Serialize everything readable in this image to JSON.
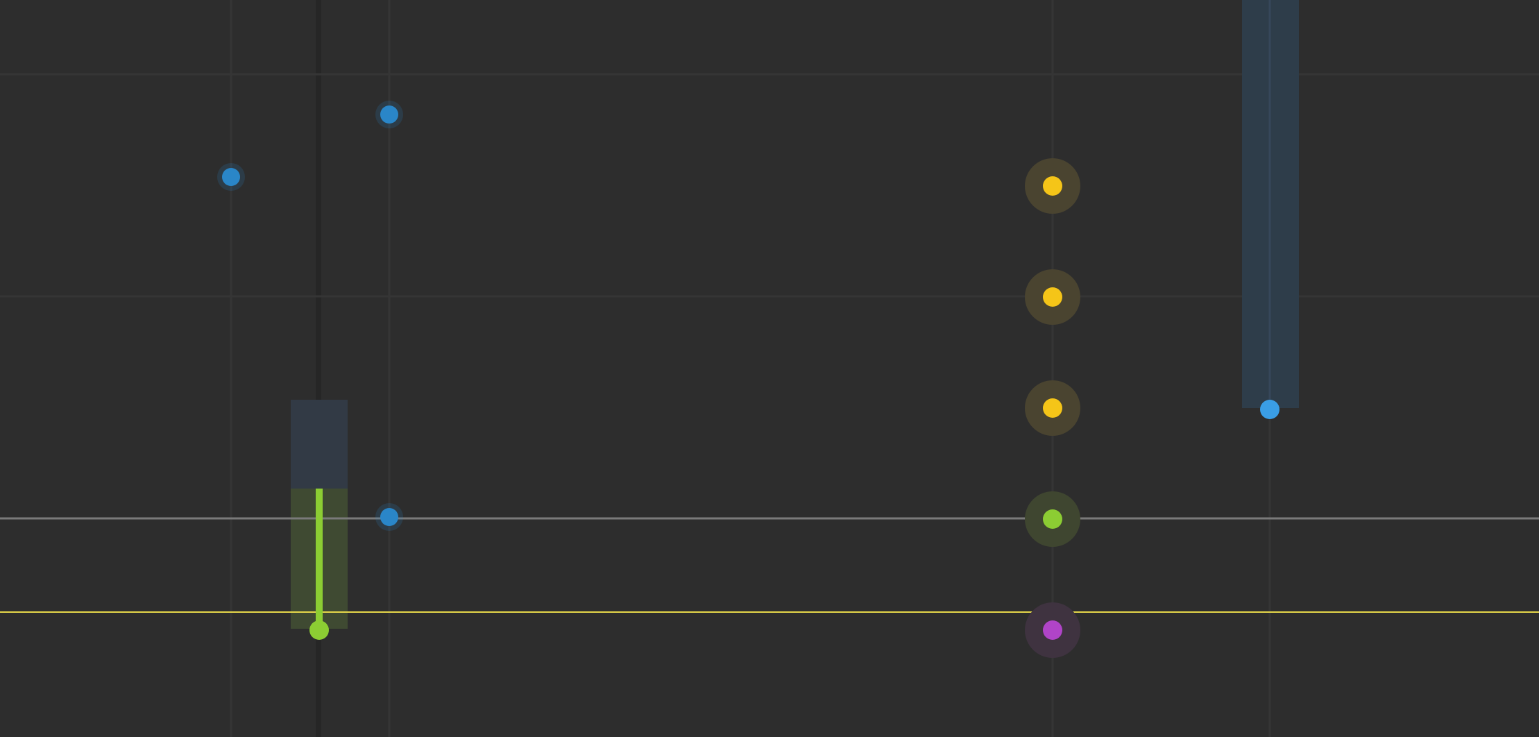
{
  "colors": {
    "background": "#2d2d2d",
    "grid_line": "#353535",
    "dark_track": "#262626",
    "playhead": "#7a7a7a",
    "threshold": "#e6d84a",
    "blue_dot": "#2a86c8",
    "blue_dot_bright": "#3a9ee6",
    "blue_region": "#2e3d4a",
    "slate_region": "#323a45",
    "green_region": "#3f4a32",
    "green": "#8ccd33",
    "yellow": "#f5c518",
    "yellow_halo": "#4a4430",
    "green_halo": "#3f4630",
    "purple": "#b044c8",
    "purple_halo": "#3f3340"
  },
  "icons": {
    "keyframe": "circle-dot-icon",
    "selected_keyframe": "halo-circle-icon"
  },
  "marker_column": {
    "markers": [
      {
        "name": "yellow-keyframe-1",
        "color_key": "yellow",
        "halo_key": "yellow_halo"
      },
      {
        "name": "yellow-keyframe-2",
        "color_key": "yellow",
        "halo_key": "yellow_halo"
      },
      {
        "name": "yellow-keyframe-3",
        "color_key": "yellow",
        "halo_key": "yellow_halo"
      },
      {
        "name": "green-keyframe",
        "color_key": "green",
        "halo_key": "green_halo"
      },
      {
        "name": "purple-keyframe",
        "color_key": "purple",
        "halo_key": "purple_halo"
      }
    ]
  }
}
